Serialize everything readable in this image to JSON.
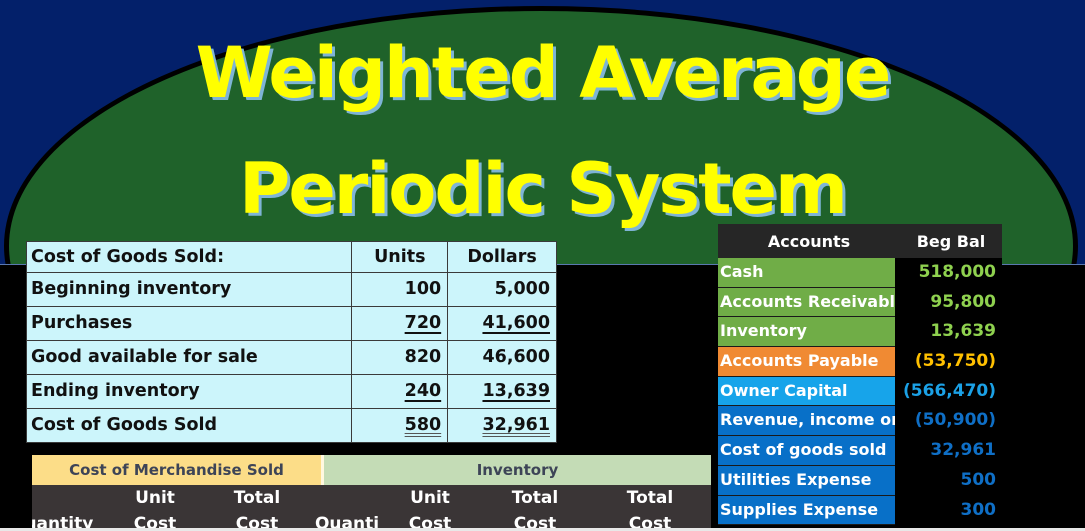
{
  "title": {
    "line1": "Weighted Average",
    "line2": "Periodic System"
  },
  "colors": {
    "background_blue": "#03206a",
    "ellipse_green": "#1f622a",
    "title_yellow": "#ffff00",
    "cogs_table_bg": "#ccf5fb",
    "asset_green": "#70ad47",
    "liability_orange": "#f08a33",
    "equity_blue": "#17a4ea",
    "income_blue": "#0870c8"
  },
  "cogs_table": {
    "header": {
      "label": "Cost of Goods Sold:",
      "units": "Units",
      "dollars": "Dollars"
    },
    "rows": [
      {
        "label": "Beginning inventory",
        "units": "100",
        "dollars": "5,000",
        "underline": "none"
      },
      {
        "label": "Purchases",
        "units": "720",
        "dollars": "41,600",
        "underline": "single"
      },
      {
        "label": "Good available for sale",
        "units": "820",
        "dollars": "46,600",
        "underline": "none"
      },
      {
        "label": "Ending inventory",
        "units": "240",
        "dollars": "13,639",
        "underline": "single"
      },
      {
        "label": "Cost of Goods Sold",
        "units": "580",
        "dollars": "32,961",
        "underline": "double"
      }
    ]
  },
  "accounts_table": {
    "header": {
      "name": "Accounts",
      "balance": "Beg Bal"
    },
    "rows": [
      {
        "name": "Cash",
        "balance": "518,000",
        "name_bg": "#70ad47",
        "value_color": "#8fd14f"
      },
      {
        "name": "Accounts Receivable",
        "balance": "95,800",
        "name_bg": "#70ad47",
        "value_color": "#8fd14f"
      },
      {
        "name": "Inventory",
        "balance": "13,639",
        "name_bg": "#70ad47",
        "value_color": "#8fd14f"
      },
      {
        "name": "Accounts Payable",
        "balance": "(53,750)",
        "name_bg": "#f08a33",
        "value_color": "#ffc000"
      },
      {
        "name": "Owner Capital",
        "balance": "(566,470)",
        "name_bg": "#17a4ea",
        "value_color": "#1ba1e6"
      },
      {
        "name": "Revenue, income or s",
        "balance": "(50,900)",
        "name_bg": "#0870c8",
        "value_color": "#0f6fc6"
      },
      {
        "name": "Cost of goods sold",
        "balance": "32,961",
        "name_bg": "#0870c8",
        "value_color": "#0f6fc6"
      },
      {
        "name": "Utilities Expense",
        "balance": "500",
        "name_bg": "#0870c8",
        "value_color": "#0f6fc6"
      },
      {
        "name": "Supplies Expense",
        "balance": "300",
        "name_bg": "#0870c8",
        "value_color": "#0f6fc6"
      }
    ]
  },
  "merchandise_table": {
    "group_headers": {
      "cost_of_merchandise_sold": "Cost of Merchandise Sold",
      "inventory": "Inventory"
    },
    "columns": [
      {
        "line1": "",
        "line2": "Quantity"
      },
      {
        "line1": "Unit",
        "line2": "Cost"
      },
      {
        "line1": "Total",
        "line2": "Cost"
      },
      {
        "line1": "",
        "line2": "Quanti"
      },
      {
        "line1": "Unit",
        "line2": "Cost"
      },
      {
        "line1": "Total",
        "line2": "Cost"
      },
      {
        "line1": "Total",
        "line2": "Cost"
      }
    ]
  }
}
